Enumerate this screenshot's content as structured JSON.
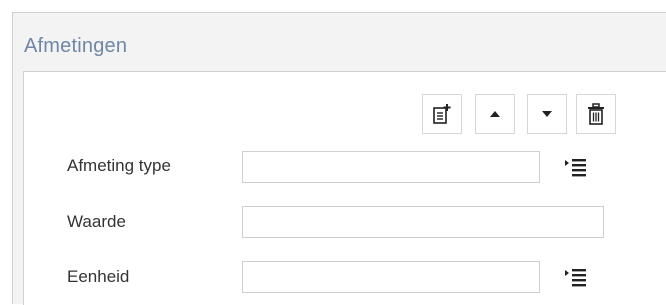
{
  "panel": {
    "title": "Afmetingen"
  },
  "toolbar": {
    "buttons": [
      {
        "name": "add-record-icon"
      },
      {
        "name": "move-up-icon"
      },
      {
        "name": "move-down-icon"
      },
      {
        "name": "delete-icon"
      }
    ]
  },
  "form": {
    "fields": [
      {
        "label": "Afmeting type",
        "value": "",
        "has_list_picker": true
      },
      {
        "label": "Waarde",
        "value": "",
        "has_list_picker": false
      },
      {
        "label": "Eenheid",
        "value": "",
        "has_list_picker": true
      }
    ]
  },
  "colors": {
    "title": "#6f86a6",
    "panel_bg": "#f3f3f3",
    "border": "#cfcfcf",
    "label_text": "#333333"
  }
}
